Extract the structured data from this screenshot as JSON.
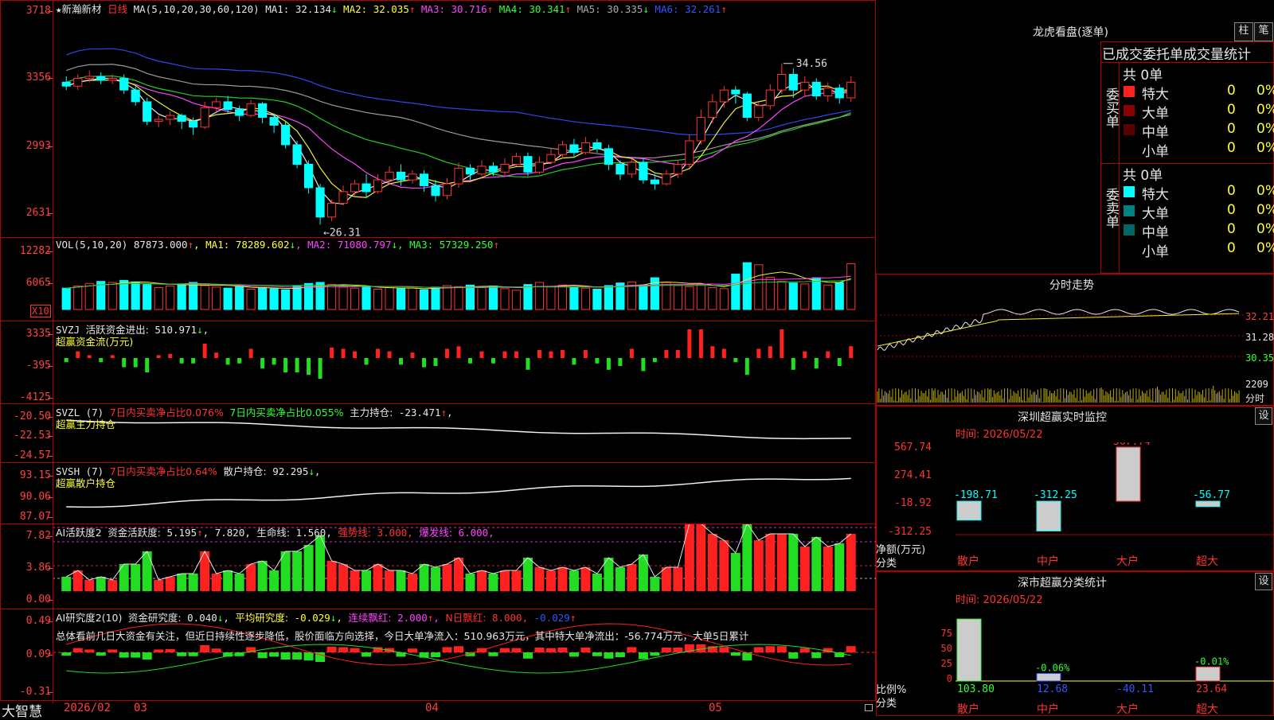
{
  "main": {
    "stock_name": "新瀚新材",
    "period": "日线",
    "ma_header": "MA(5,10,20,30,60,120)",
    "ma_values": [
      {
        "label": "MA1:",
        "value": "32.134",
        "arrow": "↓",
        "color": "#e6e6e6"
      },
      {
        "label": "MA2:",
        "value": "32.035",
        "arrow": "↑",
        "color": "#ffff33"
      },
      {
        "label": "MA3:",
        "value": "30.716",
        "arrow": "↑",
        "color": "#ff44ff"
      },
      {
        "label": "MA4:",
        "value": "30.341",
        "arrow": "↑",
        "color": "#33ff33"
      },
      {
        "label": "MA5:",
        "value": "30.335",
        "arrow": "↓",
        "color": "#aaaaaa"
      },
      {
        "label": "MA6:",
        "value": "32.261",
        "arrow": "↑",
        "color": "#3355ff"
      }
    ],
    "y_ticks": [
      "3718",
      "3356",
      "2993",
      "2631"
    ],
    "high_label": "34.56",
    "low_label": "26.31"
  },
  "vol": {
    "header": "VOL(5,10,20)",
    "value": "87873.000",
    "ma": [
      {
        "label": "MA1:",
        "value": "78289.602",
        "arrow": "↓",
        "color": "#ffff33"
      },
      {
        "label": "MA2:",
        "value": "71080.797",
        "arrow": "↓",
        "color": "#ff44ff"
      },
      {
        "label": "MA3:",
        "value": "57329.250",
        "arrow": "↑",
        "color": "#33ff33"
      }
    ],
    "y_ticks": [
      "12282",
      "6065"
    ],
    "unit": "X10"
  },
  "svzj": {
    "header": "SVZJ",
    "label": "活跃资金进出:",
    "value": "510.971",
    "arrow": "↓",
    "subtitle": "超赢资金流(万元)",
    "y_ticks": [
      "3335",
      "-395",
      "-4125"
    ]
  },
  "svzl": {
    "header": "SVZL (7)",
    "t1": "7日内买卖净占比0.076%",
    "t2": "7日内买卖净占比0.055%",
    "t3": "主力持仓:",
    "value": "-23.471",
    "arrow": "↑",
    "subtitle": "超赢主力持仓",
    "y_ticks": [
      "-20.50",
      "-22.53",
      "-24.57"
    ]
  },
  "svsh": {
    "header": "SVSH (7)",
    "t1": "7日内买卖净占比0.64%",
    "t2": "散户持仓:",
    "value": "92.295",
    "arrow": "↓",
    "subtitle": "超赢散户持仓",
    "y_ticks": [
      "93.15",
      "90.06",
      "87.07"
    ]
  },
  "ai1": {
    "header": "AI活跃度2",
    "l1": "资金活跃度:",
    "v1": "5.195",
    "v2": "7.820",
    "l3": "生命线:",
    "v3": "1.560",
    "l4": "强势线:",
    "v4": "3.000",
    "l5": "爆发线:",
    "v5": "6.000",
    "y_ticks": [
      "7.82",
      "3.86",
      "0.00"
    ]
  },
  "ai2": {
    "header": "AI研究度2(10)",
    "l1": "资金研究度:",
    "v1": "0.040",
    "l2": "平均研究度:",
    "v2": "-0.029",
    "l3": "连续飘红:",
    "v3": "2.000",
    "l4": "N日飘红:",
    "v4": "8.000",
    "v5": "-0.029",
    "comment": "总体看前几日大资金有关注，但近日持续性逐步降低，股价面临方向选择，今日大单净流入：510.963万元，其中特大单净流出：-56.774万元，大单5日累计",
    "y_ticks": [
      "0.49",
      "0.09",
      "-0.31"
    ]
  },
  "xaxis": {
    "brand": "大智慧",
    "labels": [
      "2026/02",
      "03",
      "04",
      "05"
    ]
  },
  "right": {
    "top_title": "龙虎看盘(逐单)",
    "btn1": "柱",
    "btn2": "笔",
    "stats_title": "已成交委托单成交量统计",
    "buy_label": "委买单",
    "sell_label": "委卖单",
    "buy_total": "共 0单",
    "sell_total": "共 0单",
    "buy_rows": [
      {
        "name": "特大",
        "count": "0",
        "pct": "0%",
        "color": "#ff2020"
      },
      {
        "name": "大单",
        "count": "0",
        "pct": "0%",
        "color": "#8b0000"
      },
      {
        "name": "中单",
        "count": "0",
        "pct": "0%",
        "color": "#5a0000"
      },
      {
        "name": "小单",
        "count": "0",
        "pct": "0%",
        "color": ""
      }
    ],
    "sell_rows": [
      {
        "name": "特大",
        "count": "0",
        "pct": "0%",
        "color": "#00ffff"
      },
      {
        "name": "大单",
        "count": "0",
        "pct": "0%",
        "color": "#008080"
      },
      {
        "name": "中单",
        "count": "0",
        "pct": "0%",
        "color": "#006666"
      },
      {
        "name": "小单",
        "count": "0",
        "pct": "0%",
        "color": ""
      }
    ],
    "intraday_title": "分时走势",
    "intraday_ticks": [
      "32.21",
      "31.28",
      "30.35",
      "2209"
    ],
    "intraday_unit": "分时",
    "sz_monitor_title": "深圳超赢实时监控",
    "settings": "设",
    "date_label": "时间:",
    "date_value": "2026/05/22",
    "monitor_ticks": [
      "567.74",
      "274.41",
      "-18.92",
      "-312.25"
    ],
    "monitor_unit_a": "净额(万元)",
    "monitor_unit_b": "分类",
    "class_title": "深市超赢分类统计",
    "class_ticks": [
      "75",
      "50",
      "25",
      "0"
    ],
    "class_unit_a": "比例%",
    "class_unit_b": "分类",
    "categories": [
      "散户",
      "中户",
      "大户",
      "超大"
    ]
  },
  "chart_data": [
    {
      "type": "candlestick",
      "title": "新瀚新材 日线",
      "ylim": [
        26.0,
        37.4
      ],
      "x": [
        "2026/02",
        "03",
        "04",
        "05"
      ],
      "ohlc": [
        [
          33.6,
          33.4,
          33.9,
          33.2
        ],
        [
          33.4,
          33.8,
          34.0,
          33.2
        ],
        [
          33.8,
          33.9,
          34.2,
          33.6
        ],
        [
          33.9,
          33.7,
          34.1,
          33.5
        ],
        [
          33.7,
          33.8,
          34.0,
          33.5
        ],
        [
          33.8,
          33.2,
          34.0,
          33.0
        ],
        [
          33.2,
          32.6,
          33.4,
          32.4
        ],
        [
          32.6,
          31.6,
          32.8,
          31.4
        ],
        [
          31.6,
          31.7,
          31.9,
          31.3
        ],
        [
          31.7,
          31.9,
          32.1,
          31.4
        ],
        [
          31.9,
          31.6,
          32.0,
          31.2
        ],
        [
          31.6,
          31.3,
          31.8,
          30.9
        ],
        [
          31.3,
          32.3,
          32.6,
          31.2
        ],
        [
          32.3,
          32.6,
          32.8,
          32.1
        ],
        [
          32.6,
          32.2,
          32.9,
          32.0
        ],
        [
          32.2,
          31.9,
          32.4,
          31.6
        ],
        [
          31.9,
          32.5,
          32.7,
          31.8
        ],
        [
          32.5,
          31.8,
          32.6,
          31.5
        ],
        [
          31.8,
          31.4,
          32.0,
          31.0
        ],
        [
          31.4,
          30.4,
          31.6,
          30.2
        ],
        [
          30.4,
          29.4,
          30.6,
          29.2
        ],
        [
          29.4,
          28.2,
          29.6,
          27.9
        ],
        [
          28.2,
          26.7,
          28.4,
          26.31
        ],
        [
          26.7,
          27.4,
          27.6,
          26.5
        ],
        [
          27.4,
          28.0,
          28.3,
          27.3
        ],
        [
          28.0,
          28.4,
          28.6,
          27.8
        ],
        [
          28.4,
          28.0,
          28.9,
          27.7
        ],
        [
          28.0,
          28.6,
          28.9,
          27.9
        ],
        [
          28.6,
          29.0,
          29.3,
          28.4
        ],
        [
          29.0,
          28.6,
          29.4,
          28.3
        ],
        [
          28.6,
          28.9,
          29.1,
          28.4
        ],
        [
          28.9,
          28.3,
          29.1,
          28.0
        ],
        [
          28.3,
          27.8,
          28.6,
          27.5
        ],
        [
          27.8,
          28.4,
          28.7,
          27.6
        ],
        [
          28.4,
          29.2,
          29.5,
          28.2
        ],
        [
          29.2,
          28.9,
          29.4,
          28.6
        ],
        [
          28.9,
          29.3,
          29.6,
          28.8
        ],
        [
          29.3,
          29.0,
          29.5,
          28.8
        ],
        [
          29.0,
          29.4,
          29.7,
          28.8
        ],
        [
          29.4,
          29.8,
          30.0,
          29.3
        ],
        [
          29.8,
          29.0,
          30.0,
          28.8
        ],
        [
          29.0,
          29.5,
          29.8,
          28.9
        ],
        [
          29.5,
          29.9,
          30.2,
          29.4
        ],
        [
          29.9,
          30.4,
          30.6,
          29.7
        ],
        [
          30.4,
          30.0,
          30.7,
          29.8
        ],
        [
          30.0,
          30.5,
          30.8,
          29.9
        ],
        [
          30.5,
          30.2,
          30.7,
          30.0
        ],
        [
          30.2,
          29.4,
          30.4,
          29.1
        ],
        [
          29.4,
          28.9,
          29.6,
          28.6
        ],
        [
          28.9,
          29.5,
          29.7,
          28.7
        ],
        [
          29.5,
          28.6,
          29.7,
          28.4
        ],
        [
          28.6,
          28.4,
          28.9,
          28.1
        ],
        [
          28.4,
          28.9,
          29.1,
          28.3
        ],
        [
          28.9,
          29.4,
          29.6,
          28.7
        ],
        [
          29.4,
          30.6,
          30.9,
          29.2
        ],
        [
          30.6,
          31.8,
          32.2,
          30.4
        ],
        [
          31.8,
          32.6,
          33.0,
          31.5
        ],
        [
          32.6,
          33.2,
          33.4,
          32.3
        ],
        [
          33.2,
          33.0,
          33.4,
          32.5
        ],
        [
          33.0,
          31.8,
          33.1,
          31.6
        ],
        [
          31.8,
          32.4,
          32.6,
          31.6
        ],
        [
          32.4,
          33.2,
          33.5,
          32.2
        ],
        [
          33.2,
          34.0,
          34.56,
          33.0
        ],
        [
          34.0,
          33.2,
          34.3,
          32.8
        ],
        [
          33.2,
          33.6,
          33.9,
          32.9
        ],
        [
          33.6,
          32.9,
          33.8,
          32.7
        ],
        [
          32.9,
          33.3,
          33.6,
          32.6
        ],
        [
          33.3,
          32.8,
          33.5,
          32.5
        ],
        [
          32.8,
          33.6,
          33.9,
          32.6
        ]
      ],
      "volume_x10": [
        4100,
        4500,
        5000,
        5400,
        5200,
        5600,
        5300,
        4800,
        4200,
        4500,
        4900,
        5200,
        4600,
        4300,
        4100,
        4400,
        3900,
        4200,
        4000,
        3800,
        4500,
        5000,
        5200,
        4800,
        4300,
        4100,
        4400,
        3900,
        4200,
        4000,
        4100,
        3800,
        4300,
        4600,
        4400,
        4700,
        4200,
        4500,
        4000,
        3700,
        4800,
        5200,
        4400,
        4700,
        4300,
        4100,
        3900,
        4600,
        5100,
        5300,
        4700,
        6100,
        5200,
        4600,
        4400,
        4800,
        4200,
        4000,
        6800,
        9000,
        8600,
        6200,
        5400,
        5100,
        4900,
        6100,
        4700,
        5200,
        8800,
        12500,
        10200,
        7400,
        6400,
        8200,
        9400,
        8600
      ]
    }
  ]
}
